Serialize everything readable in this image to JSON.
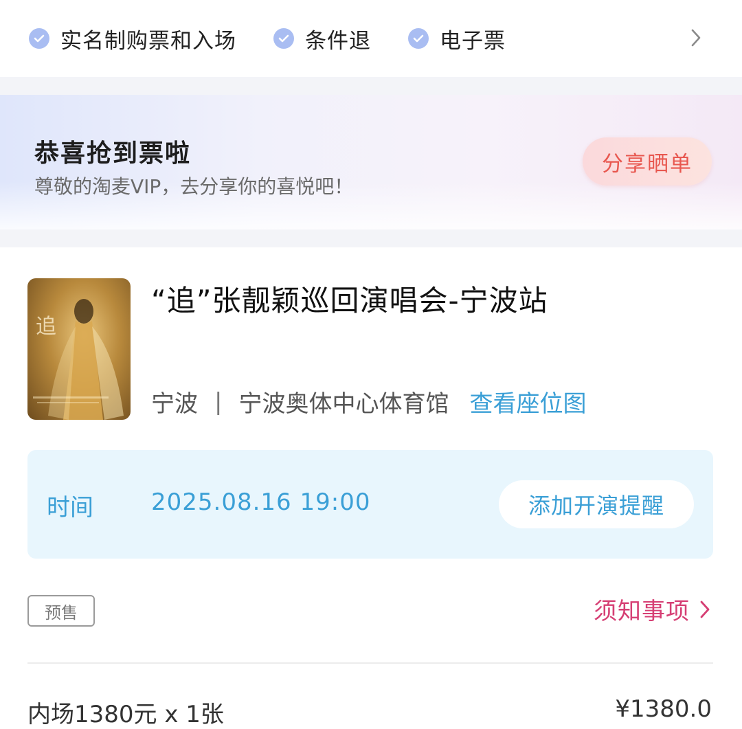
{
  "features": {
    "items": [
      {
        "label": "实名制购票和入场",
        "icon": "check-circle-icon"
      },
      {
        "label": "条件退",
        "icon": "check-circle-icon"
      },
      {
        "label": "电子票",
        "icon": "check-circle-icon"
      }
    ],
    "more_icon": "chevron-right-icon"
  },
  "banner": {
    "title": "恭喜抢到票啦",
    "subtitle": "尊敬的淘麦VIP，去分享你的喜悦吧！",
    "share_label": "分享晒单"
  },
  "show": {
    "title": "“追”张靓颖巡回演唱会-宁波站",
    "city": "宁波",
    "separator": "|",
    "venue": "宁波奥体中心体育馆",
    "seat_map_label": "查看座位图",
    "poster_icon": "poster-image"
  },
  "time": {
    "label": "时间",
    "value": "2025.08.16 19:00",
    "remind_label": "添加开演提醒"
  },
  "badge": {
    "presale": "预售"
  },
  "notice": {
    "label": "须知事项"
  },
  "ticket": {
    "description": "内场1380元 x 1张",
    "price": "¥1380.0"
  },
  "colors": {
    "accent_blue": "#3a9fd6",
    "accent_pink": "#d63f74",
    "share_red": "#e8574f",
    "check_blue": "#a9bdf2",
    "time_bg": "#e8f6fd"
  }
}
